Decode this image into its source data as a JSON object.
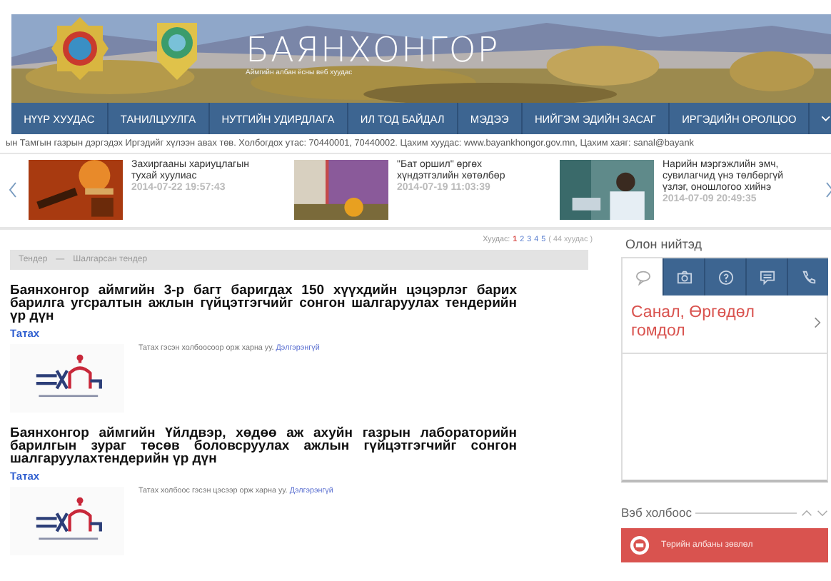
{
  "header": {
    "title": "БАЯНХОНГОР",
    "subtitle": "Аймгийн албан ёсны веб хуудас"
  },
  "nav": [
    {
      "label": "НҮҮР ХУУДАС"
    },
    {
      "label": "ТАНИЛЦУУЛГА"
    },
    {
      "label": "НУТГИЙН УДИРДЛАГА"
    },
    {
      "label": "ИЛ ТОД БАЙДАЛ"
    },
    {
      "label": "МЭДЭЭ"
    },
    {
      "label": "НИЙГЭМ ЭДИЙН ЗАСАГ"
    },
    {
      "label": "ИРГЭДИЙН ОРОЛЦОО"
    }
  ],
  "ticker": "ын Тамгын газрын дэргэдэх Иргэдийг хүлээн авах төв. Холбогдох утас: 70440001, 70440002. Цахим хуудас: www.bayankhongor.gov.mn, Цахим хаяг: sanal@bayank",
  "news": [
    {
      "title": "Захиргааны хариуцлагын тухай хуулиас",
      "date": "2014-07-22 19:57:43",
      "kind": "picture"
    },
    {
      "title": "\"Бат оршил\" өргөх хүндэтгэлийн хөтөлбөр",
      "date": "2014-07-19 11:03:39",
      "kind": "picture"
    },
    {
      "title": "Нарийн мэргэжлийн эмч, сувилагчид үнэ төлбөргүй үзлэг, оношлогоо хийнэ",
      "date": "2014-07-09 20:49:35",
      "kind": "picture"
    }
  ],
  "pagination": {
    "label": "Хуудас:",
    "pages": [
      {
        "label": "1",
        "selected": true
      },
      {
        "label": "2",
        "selected": false
      },
      {
        "label": "3",
        "selected": false
      },
      {
        "label": "4",
        "selected": false
      },
      {
        "label": "5",
        "selected": false
      }
    ],
    "total": "( 44 хуудас )"
  },
  "breadcrumb": [
    "Тендер",
    "Шалгарсан тендер"
  ],
  "breadcrumb_separator": "—",
  "articles": [
    {
      "title": "Баянхонгор аймгийн 3-р багт баригдах 150 хүүхдийн цэцэрлэг барих барилга угсралтын ажлын гүйцэтгэгчийг сонгон шалгаруулах тендерийн үр дүн",
      "download": "Татах",
      "summary": "Татах гэсэн холбоосоор орж харна уу.",
      "more": "Дэлгэрэнгүй"
    },
    {
      "title": "Баянхонгор аймгийн Үйлдвэр, хөдөө аж ахуйн газрын лабораторийн барилгын зураг төсөв боловсруулах ажлын гүйцэтгэгчийг сонгон шалгаруулахтендерийн үр дүн",
      "download": "Татах",
      "summary": "Татах холбоос гэсэн цэсээр орж харна уу.",
      "more": "Дэлгэрэнгүй"
    }
  ],
  "public": {
    "title": "Олон нийтэд",
    "tabs": [
      {
        "kind": "chat",
        "selected": true
      },
      {
        "kind": "camera",
        "selected": false
      },
      {
        "kind": "question",
        "selected": false
      },
      {
        "kind": "message",
        "selected": false
      },
      {
        "kind": "phone",
        "selected": false
      }
    ],
    "link": "Санал, Өргөдөл гомдол"
  },
  "links": {
    "title": "Вэб холбоос",
    "items": [
      {
        "label": "Төрийн албаны зөвлөл"
      }
    ]
  }
}
